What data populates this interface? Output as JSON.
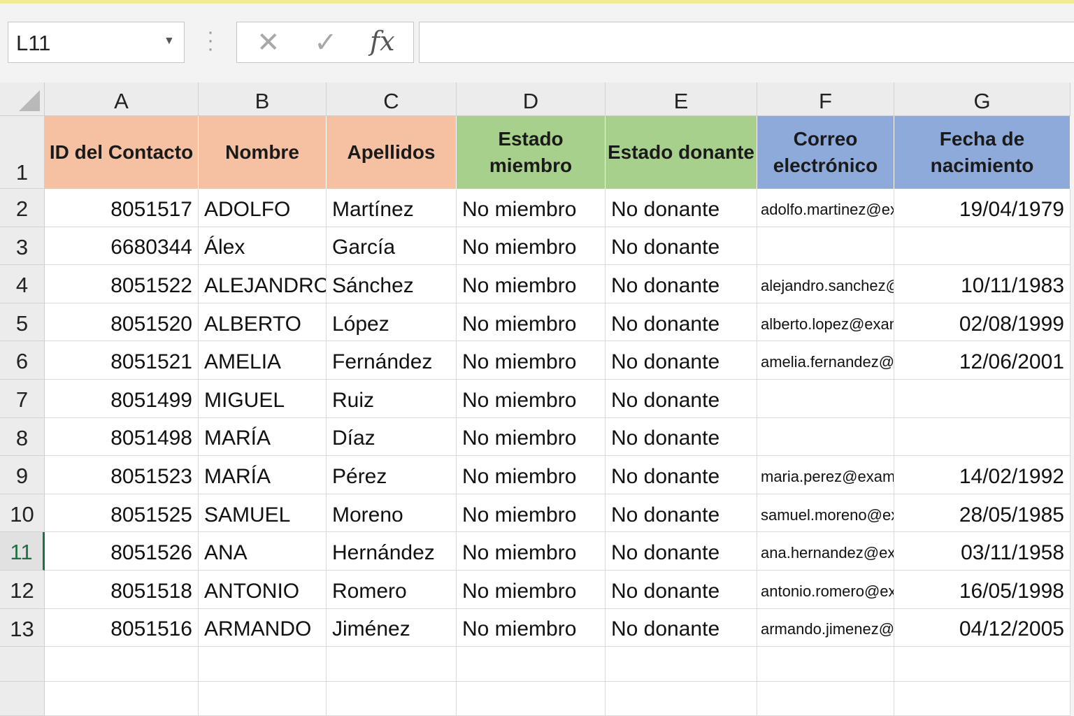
{
  "formula_bar": {
    "name_box": "L11",
    "formula": ""
  },
  "icons": {
    "dropdown": "chevron-down-icon",
    "cancel": "close-icon",
    "enter": "check-icon",
    "function": "fx-icon"
  },
  "colors": {
    "header_orange": "#f5c1a2",
    "header_green": "#a8d08d",
    "header_blue": "#8eaadb",
    "selection_green": "#1e7145"
  },
  "columns": [
    "A",
    "B",
    "C",
    "D",
    "E",
    "F",
    "G"
  ],
  "row_numbers": [
    "1",
    "2",
    "3",
    "4",
    "5",
    "6",
    "7",
    "8",
    "9",
    "10",
    "11",
    "12",
    "13"
  ],
  "headers": [
    "ID del Contacto",
    "Nombre",
    "Apellidos",
    "Estado miembro",
    "Estado donante",
    "Correo\nelectrónico",
    "Fecha de\nnacimiento"
  ],
  "rows": [
    [
      "8051517",
      "ADOLFO",
      "Martínez",
      "No miembro",
      "No donante",
      "adolfo.martinez@example.es",
      "19/04/1979"
    ],
    [
      "6680344",
      "Álex",
      "García",
      "No miembro",
      "No donante",
      "",
      ""
    ],
    [
      "8051522",
      "ALEJANDRO",
      "Sánchez",
      "No miembro",
      "No donante",
      "alejandro.sanchez@example.es",
      "10/11/1983"
    ],
    [
      "8051520",
      "ALBERTO",
      "López",
      "No miembro",
      "No donante",
      "alberto.lopez@example.es",
      "02/08/1999"
    ],
    [
      "8051521",
      "AMELIA",
      "Fernández",
      "No miembro",
      "No donante",
      "amelia.fernandez@example.es",
      "12/06/2001"
    ],
    [
      "8051499",
      "MIGUEL",
      "Ruiz",
      "No miembro",
      "No donante",
      "",
      ""
    ],
    [
      "8051498",
      "MARÍA",
      "Díaz",
      "No miembro",
      "No donante",
      "",
      ""
    ],
    [
      "8051523",
      "MARÍA",
      "Pérez",
      "No miembro",
      "No donante",
      "maria.perez@example.es",
      "14/02/1992"
    ],
    [
      "8051525",
      "SAMUEL",
      "Moreno",
      "No miembro",
      "No donante",
      "samuel.moreno@example.es",
      "28/05/1985"
    ],
    [
      "8051526",
      "ANA",
      "Hernández",
      "No miembro",
      "No donante",
      "ana.hernandez@example.es",
      "03/11/1958"
    ],
    [
      "8051518",
      "ANTONIO",
      "Romero",
      "No miembro",
      "No donante",
      "antonio.romero@example.es",
      "16/05/1998"
    ],
    [
      "8051516",
      "ARMANDO",
      "Jiménez",
      "No miembro",
      "No donante",
      "armando.jimenez@example.es",
      "04/12/2005"
    ]
  ],
  "selected_row": "11"
}
